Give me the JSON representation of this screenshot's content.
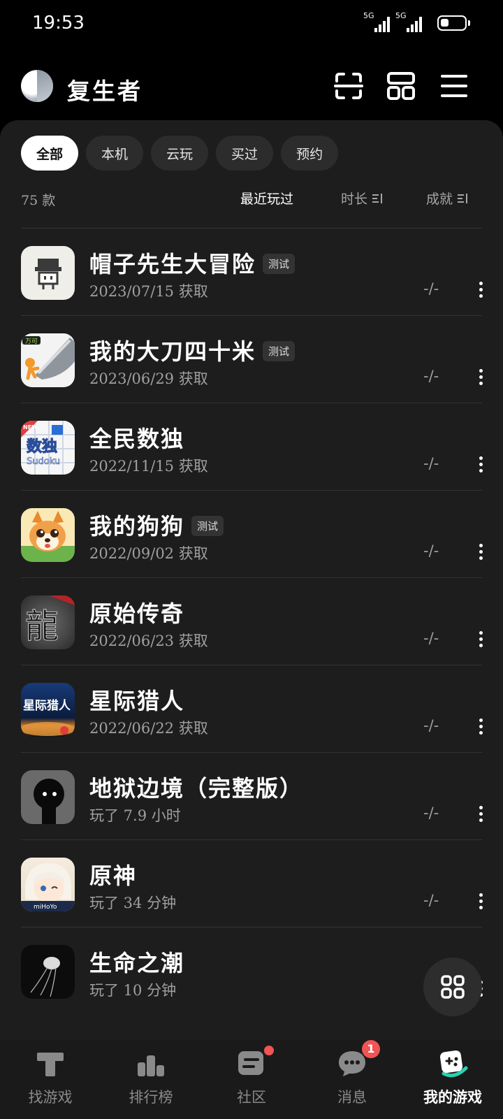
{
  "status_bar": {
    "time": "19:53",
    "network_1": "5G",
    "network_2": "5G",
    "battery_level": 0.35
  },
  "header": {
    "username": "复生者",
    "icons": [
      "scan-icon",
      "layout-icon",
      "menu-icon"
    ]
  },
  "filters": [
    {
      "label": "全部",
      "active": true
    },
    {
      "label": "本机",
      "active": false
    },
    {
      "label": "云玩",
      "active": false
    },
    {
      "label": "买过",
      "active": false
    },
    {
      "label": "预约",
      "active": false
    }
  ],
  "summary": {
    "count": "75 款",
    "sort_recent": "最近玩过",
    "sort_duration": "时长",
    "sort_achievement": "成就"
  },
  "games": [
    {
      "name": "帽子先生大冒险",
      "badge": "测试",
      "sub": "2023/07/15 获取",
      "ach": "-/-"
    },
    {
      "name": "我的大刀四十米",
      "badge": "测试",
      "sub": "2023/06/29 获取",
      "ach": "-/-"
    },
    {
      "name": "全民数独",
      "badge": "",
      "sub": "2022/11/15 获取",
      "ach": "-/-",
      "icon_text": "数独",
      "icon_sub": "Sudoku",
      "icon_tag": "NEW"
    },
    {
      "name": "我的狗狗",
      "badge": "测试",
      "sub": "2022/09/02 获取",
      "ach": "-/-"
    },
    {
      "name": "原始传奇",
      "badge": "",
      "sub": "2022/06/23 获取",
      "ach": "-/-",
      "icon_text": "龍"
    },
    {
      "name": "星际猎人",
      "badge": "",
      "sub": "2022/06/22 获取",
      "ach": "-/-",
      "icon_text": "星际猎人"
    },
    {
      "name": "地狱边境（完整版）",
      "badge": "",
      "sub": "玩了 7.9 小时",
      "ach": "-/-"
    },
    {
      "name": "原神",
      "badge": "",
      "sub": "玩了 34 分钟",
      "ach": "-/-",
      "icon_text": "miHoYo"
    },
    {
      "name": "生命之潮",
      "badge": "",
      "sub": "玩了 10 分钟",
      "ach": "-/-"
    }
  ],
  "bottom_nav": [
    {
      "label": "找游戏",
      "icon": "find-game-icon",
      "active": false
    },
    {
      "label": "排行榜",
      "icon": "ranking-icon",
      "active": false
    },
    {
      "label": "社区",
      "icon": "community-icon",
      "active": false
    },
    {
      "label": "消息",
      "icon": "message-icon",
      "active": false,
      "badge": "1"
    },
    {
      "label": "我的游戏",
      "icon": "my-games-icon",
      "active": true
    }
  ],
  "colors": {
    "background": "#000000",
    "panel": "#1d1d1d",
    "accent_badge": "#f05454",
    "accent_teal": "#27d3b0"
  }
}
